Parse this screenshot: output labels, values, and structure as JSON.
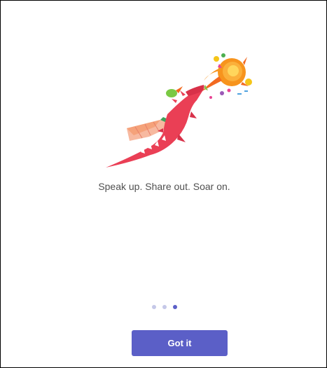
{
  "onboarding": {
    "tagline": "Speak up. Share out. Soar on.",
    "pager": {
      "total": 3,
      "current": 3
    },
    "primary_button_label": "Got it",
    "illustration_icon": "dragon-breathing-fire-illustration"
  },
  "colors": {
    "accent": "#5b5fc7",
    "pager_inactive": "#c5c8e8",
    "text": "#505050",
    "dragon": "#ea3f55",
    "fire": "#f7941d"
  }
}
